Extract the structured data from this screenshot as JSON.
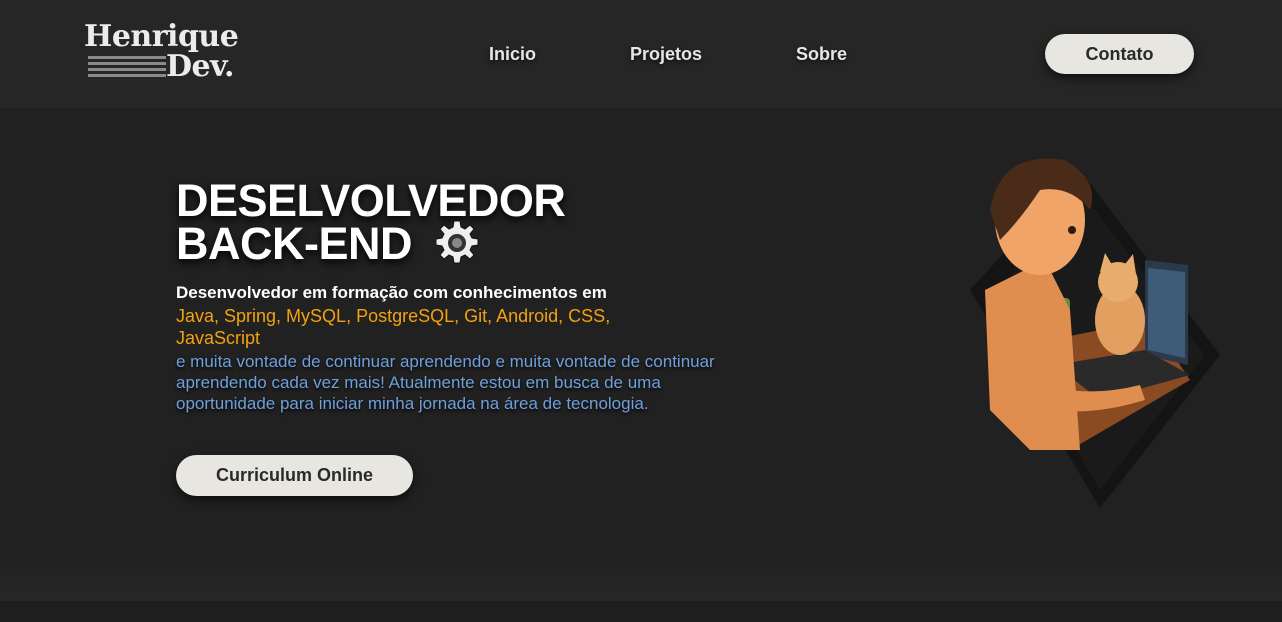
{
  "logo": {
    "line1": "Henrique",
    "line2": "Dev."
  },
  "nav": {
    "items": [
      "Inicio",
      "Projetos",
      "Sobre"
    ]
  },
  "header": {
    "contact_label": "Contato"
  },
  "hero": {
    "title_line1": "DESELVOLVEDOR",
    "title_line2": "BACK-END",
    "intro": "Desenvolvedor em formação com conhecimentos em",
    "techs": "Java, Spring, MySQL, PostgreSQL, Git, Android, CSS, JavaScript",
    "description": "e muita vontade de continuar aprendendo e muita vontade de continuar aprendendo cada vez mais! Atualmente estou em busca de uma oportunidade para iniciar minha jornada na área de tecnologia.",
    "cv_label": "Curriculum Online"
  },
  "icons": {
    "title_icon": "gear-icon",
    "illustration": "developer-with-cat-illustration"
  },
  "colors": {
    "background": "#212121",
    "header": "#262626",
    "accent_orange": "#f2a20f",
    "accent_blue": "#6f9fdc",
    "button": "#e8e6e0"
  }
}
